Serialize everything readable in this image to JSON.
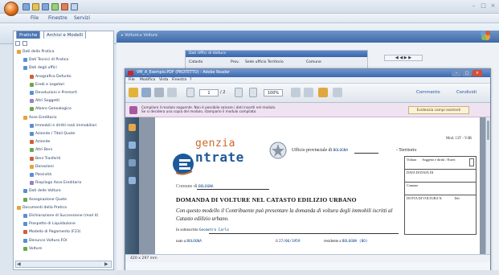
{
  "app": {
    "quick_access": [
      "new",
      "open",
      "save",
      "undo",
      "redo",
      "print"
    ],
    "menu": [
      "File",
      "Finestre",
      "Servizi"
    ],
    "window_controls": {
      "minimize": "–",
      "maximize": "□",
      "close": "×"
    }
  },
  "left_panel": {
    "tabs": [
      "Pratiche",
      "Archivi e Modelli"
    ],
    "tree": [
      {
        "label": "Dati della Pratica",
        "level": 0,
        "color": "#e8a23a"
      },
      {
        "label": "Dati Tecnici di Pratica",
        "level": 1,
        "color": "#5b8fd0"
      },
      {
        "label": "Dati degli uffici",
        "level": 1,
        "color": "#5b8fd0"
      },
      {
        "label": "Anagrafica Defunto",
        "level": 2,
        "color": "#d0603a"
      },
      {
        "label": "Eredi e Legatari",
        "level": 2,
        "color": "#6aa84f"
      },
      {
        "label": "Devoluzioni e Premorti",
        "level": 2,
        "color": "#5b8fd0"
      },
      {
        "label": "Altri Soggetti",
        "level": 2,
        "color": "#9b7fc6"
      },
      {
        "label": "Albero Genealogico",
        "level": 2,
        "color": "#6aa84f"
      },
      {
        "label": "Asse Ereditario",
        "level": 1,
        "color": "#e8a23a"
      },
      {
        "label": "Immobili e diritti reali immobiliari",
        "level": 2,
        "color": "#5b8fd0"
      },
      {
        "label": "Aziende / Titoli Quote",
        "level": 2,
        "color": "#5b8fd0"
      },
      {
        "label": "Aziende",
        "level": 2,
        "color": "#d0603a"
      },
      {
        "label": "Altri Beni",
        "level": 2,
        "color": "#6aa84f"
      },
      {
        "label": "Beni Trasferiti",
        "level": 2,
        "color": "#d0603a"
      },
      {
        "label": "Donazioni",
        "level": 2,
        "color": "#e8a23a"
      },
      {
        "label": "Passività",
        "level": 2,
        "color": "#5b8fd0"
      },
      {
        "label": "Riepilogo Asse Ereditario",
        "level": 2,
        "color": "#9b7fc6"
      },
      {
        "label": "Dati delle Volture",
        "level": 1,
        "color": "#5b8fd0"
      },
      {
        "label": "Assegnazione Quote",
        "level": 1,
        "color": "#6aa84f"
      },
      {
        "label": "Documenti della Pratica",
        "level": 0,
        "color": "#e8a23a"
      },
      {
        "label": "Dichiarazione di Successione (mod 4)",
        "level": 1,
        "color": "#5b8fd0"
      },
      {
        "label": "Prospetto di Liquidazione",
        "level": 1,
        "color": "#5b8fd0"
      },
      {
        "label": "Modello di Pagamento (F23)",
        "level": 1,
        "color": "#d0603a"
      },
      {
        "label": "Denunce Voltura FOI",
        "level": 1,
        "color": "#5b8fd0"
      },
      {
        "label": "Volture",
        "level": 1,
        "color": "#6aa84f"
      }
    ],
    "scroll_left": "◀",
    "scroll_right": "▶"
  },
  "main": {
    "header": "▸ Volture   ▸ Volture",
    "background_form": {
      "title": "Dati Uffici di Voltura",
      "columns": [
        "Catasto",
        "Prov.",
        "Sede ufficio Territorio",
        "Comune"
      ],
      "nav": "◀ ◀ ▶ ▶"
    }
  },
  "reader": {
    "title": "VM_A_Esempio.PDF (PROTETTO) - Adobe Reader",
    "menu": [
      "File",
      "Modifica",
      "Vista",
      "Finestra",
      "?"
    ],
    "page_current": "1",
    "page_total": "/ 2",
    "zoom": "100%",
    "comment": "Commento",
    "share": "Condividi",
    "info_bar": "Compilare il modulo seguente. Non è possibile salvare i dati inseriti nel modulo.\nSe si desidera una copia del modulo, stamparlo il modulo compilato.",
    "highlight_button": "Evidenzia campi esistenti",
    "status": "420 x 297 mm",
    "document": {
      "logo_top": "genzia",
      "logo_bottom": "ntrate",
      "office_label": "Ufficio provinciale di",
      "office_value": "BOLOGNA",
      "territorio": "- Territorio",
      "mod_code": "Mod. 13T - VdR",
      "comune_label": "Comune di",
      "comune_value": "BOLOGNA",
      "title": "DOMANDA DI VOLTURE NEL CATASTO EDILIZIO URBANO",
      "intro": "Con questo modello il Contribuente può presentare la domanda di voltura degli immobili iscritti al Catasto edilizio urbano.",
      "sottoscritto_label": "Io sottoscritto",
      "sottoscritto_value": "Geometra Carlo",
      "nato_label": "nato a",
      "nato_value": "BOLOGNA",
      "il_label": "il",
      "il_value": "27/06/1959",
      "residente_label": "residente a",
      "residente_value": "BOLOGNA (BO)",
      "box": {
        "voltura_label": "Voltura",
        "voltura_options": "Soggetto e diritti / Esteri",
        "data_label": "DATA DI DATA DI",
        "comune_label": "Comune",
        "voltura_n": "DOTTA DI VOLTURA N.",
        "del": "Del"
      }
    }
  },
  "colors": {
    "accent": "#3d68ab",
    "logo_orange": "#c66a2e",
    "logo_blue": "#1d5a9a",
    "info_bar": "#efe3f1"
  }
}
